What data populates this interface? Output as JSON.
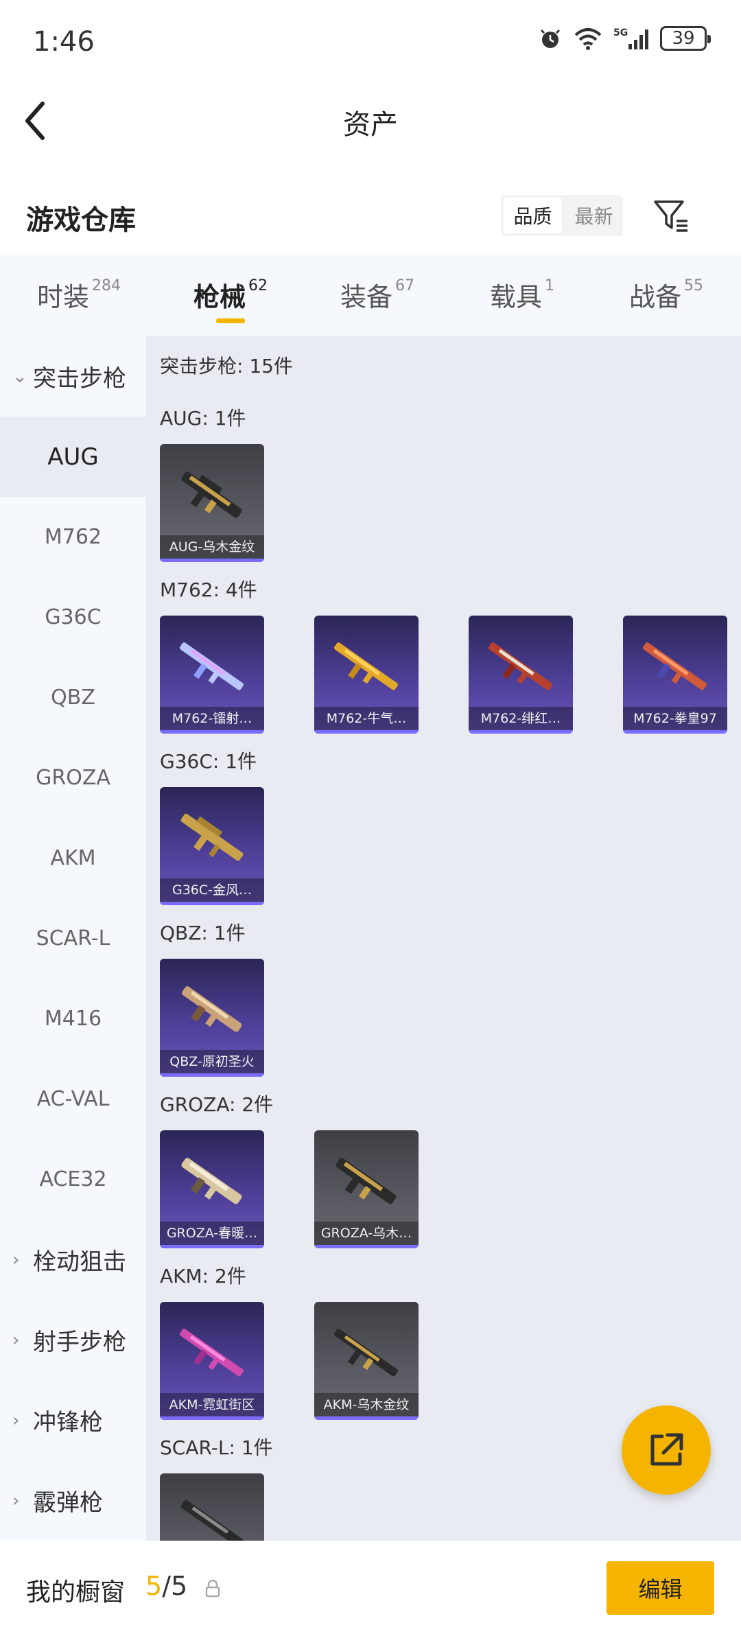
{
  "status": {
    "time": "1:46",
    "battery": "39"
  },
  "header": {
    "title": "资产"
  },
  "warehouse": {
    "label": "游戏仓库",
    "sort": [
      "品质",
      "最新"
    ]
  },
  "tabs": [
    {
      "label": "时装",
      "count": "284"
    },
    {
      "label": "枪械",
      "count": "62"
    },
    {
      "label": "装备",
      "count": "67"
    },
    {
      "label": "载具",
      "count": "1"
    },
    {
      "label": "战备",
      "count": "55"
    }
  ],
  "sidenav": {
    "groups": [
      "突击步枪",
      "栓动狙击",
      "射手步枪",
      "冲锋枪",
      "霰弹枪"
    ],
    "items": [
      "AUG",
      "M762",
      "G36C",
      "QBZ",
      "GROZA",
      "AKM",
      "SCAR-L",
      "M416",
      "AC-VAL",
      "ACE32"
    ]
  },
  "content": {
    "total": "突击步枪: 15件",
    "sections": [
      {
        "title": "AUG: 1件",
        "items": [
          {
            "label": "AUG-乌木金纹"
          }
        ]
      },
      {
        "title": "M762: 4件",
        "items": [
          {
            "label": "M762-镭射…"
          },
          {
            "label": "M762-牛气…"
          },
          {
            "label": "M762-绯红…"
          },
          {
            "label": "M762-拳皇97"
          }
        ]
      },
      {
        "title": "G36C: 1件",
        "items": [
          {
            "label": "G36C-金风…"
          }
        ]
      },
      {
        "title": "QBZ: 1件",
        "items": [
          {
            "label": "QBZ-原初圣火"
          }
        ]
      },
      {
        "title": "GROZA: 2件",
        "items": [
          {
            "label": "GROZA-春暖…"
          },
          {
            "label": "GROZA-乌木…"
          }
        ]
      },
      {
        "title": "AKM: 2件",
        "items": [
          {
            "label": "AKM-霓虹街区"
          },
          {
            "label": "AKM-乌木金纹"
          }
        ]
      },
      {
        "title": "SCAR-L: 1件",
        "items": [
          {
            "label": ""
          }
        ]
      }
    ]
  },
  "bottom": {
    "label": "我的橱窗",
    "current": "5",
    "total": "/5",
    "edit": "编辑"
  },
  "colors": {
    "accent": "#f5b400",
    "card_purple": "#4e3f98",
    "card_gray": "#5a5b62"
  },
  "icons": [
    "back-arrow-icon",
    "filter-icon",
    "share-icon",
    "lock-icon",
    "chevron-down-icon",
    "chevron-right-icon"
  ]
}
